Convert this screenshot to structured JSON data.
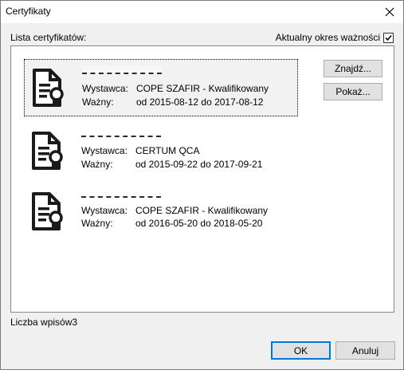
{
  "window": {
    "title": "Certyfikaty"
  },
  "list": {
    "label": "Lista certyfikatów:"
  },
  "valid_period": {
    "label": "Aktualny okres ważności",
    "checked": true
  },
  "labels": {
    "issuer": "Wystawca:",
    "valid": "Ważny:"
  },
  "certificates": [
    {
      "issuer": "COPE SZAFIR - Kwalifikowany",
      "validity": "od 2015-08-12 do 2017-08-12",
      "selected": true
    },
    {
      "issuer": "CERTUM QCA",
      "validity": "od 2015-09-22 do 2017-09-21",
      "selected": false
    },
    {
      "issuer": "COPE SZAFIR - Kwalifikowany",
      "validity": "od 2016-05-20 do 2018-05-20",
      "selected": false
    }
  ],
  "buttons": {
    "find": "Znajdź...",
    "show": "Pokaż...",
    "ok": "OK",
    "cancel": "Anuluj"
  },
  "entry_count_label": "Liczba wpisów3",
  "icons": {
    "close": "close-icon",
    "checkmark": "checkmark-icon",
    "certificate": "certificate-icon"
  }
}
